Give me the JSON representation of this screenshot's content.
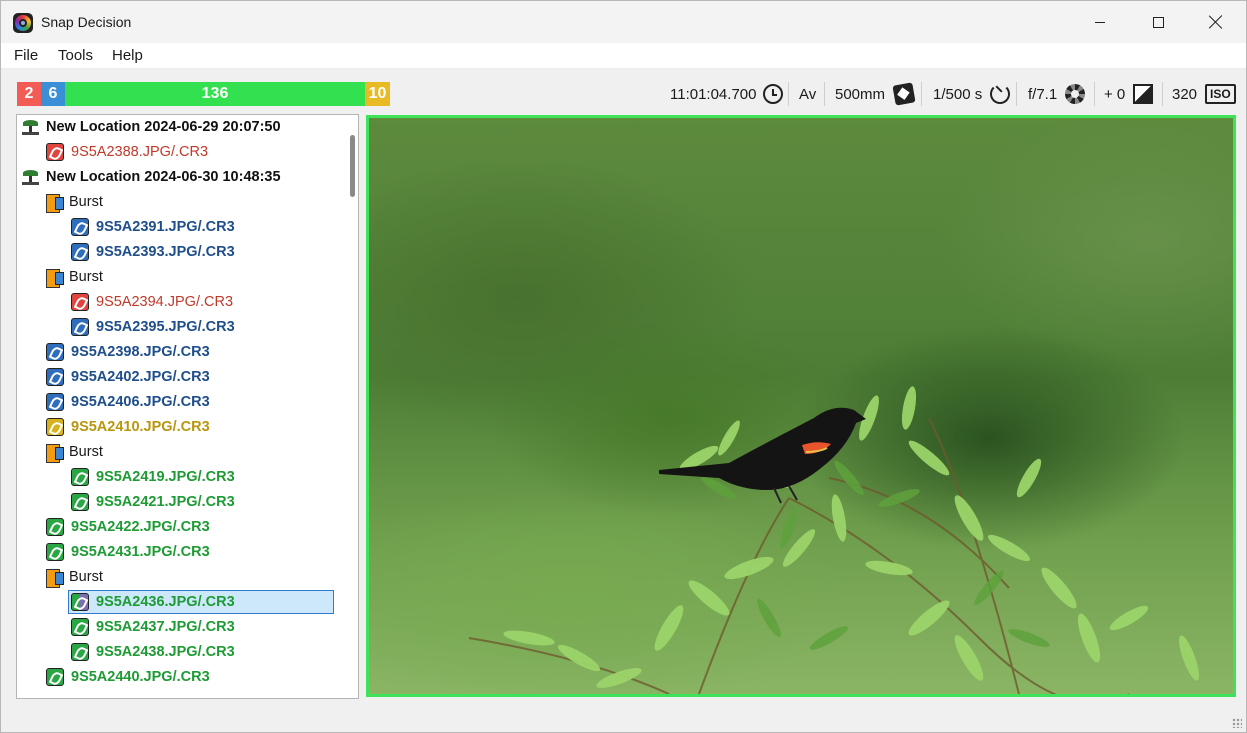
{
  "window": {
    "title": "Snap Decision"
  },
  "menu": {
    "file": "File",
    "tools": "Tools",
    "help": "Help"
  },
  "counts": {
    "rejected": "2",
    "blue": "6",
    "green": "136",
    "yellow": "10"
  },
  "exif": {
    "time": "11:01:04.700",
    "mode": "Av",
    "focal_length": "500mm",
    "shutter": "1/500 s",
    "aperture": "f/7.1",
    "exposure_comp": "+ 0",
    "iso": "320",
    "iso_badge": "ISO"
  },
  "tree": [
    {
      "kind": "location",
      "label": "New Location 2024-06-29 20:07:50"
    },
    {
      "kind": "file",
      "label": "9S5A2388.JPG/.CR3",
      "status": "rejected"
    },
    {
      "kind": "location",
      "label": "New Location 2024-06-30 10:48:35"
    },
    {
      "kind": "burst",
      "label": "Burst"
    },
    {
      "kind": "file",
      "label": "9S5A2391.JPG/.CR3",
      "status": "blue"
    },
    {
      "kind": "file",
      "label": "9S5A2393.JPG/.CR3",
      "status": "blue"
    },
    {
      "kind": "burst",
      "label": "Burst"
    },
    {
      "kind": "file",
      "label": "9S5A2394.JPG/.CR3",
      "status": "rejected"
    },
    {
      "kind": "file",
      "label": "9S5A2395.JPG/.CR3",
      "status": "blue"
    },
    {
      "kind": "file",
      "label": "9S5A2398.JPG/.CR3",
      "status": "blue"
    },
    {
      "kind": "file",
      "label": "9S5A2402.JPG/.CR3",
      "status": "blue"
    },
    {
      "kind": "file",
      "label": "9S5A2406.JPG/.CR3",
      "status": "blue"
    },
    {
      "kind": "file",
      "label": "9S5A2410.JPG/.CR3",
      "status": "yellow"
    },
    {
      "kind": "burst",
      "label": "Burst"
    },
    {
      "kind": "file",
      "label": "9S5A2419.JPG/.CR3",
      "status": "green"
    },
    {
      "kind": "file",
      "label": "9S5A2421.JPG/.CR3",
      "status": "green"
    },
    {
      "kind": "file",
      "label": "9S5A2422.JPG/.CR3",
      "status": "green"
    },
    {
      "kind": "file",
      "label": "9S5A2431.JPG/.CR3",
      "status": "green"
    },
    {
      "kind": "burst",
      "label": "Burst"
    },
    {
      "kind": "file",
      "label": "9S5A2436.JPG/.CR3",
      "status": "green",
      "selected": true
    },
    {
      "kind": "file",
      "label": "9S5A2437.JPG/.CR3",
      "status": "green"
    },
    {
      "kind": "file",
      "label": "9S5A2438.JPG/.CR3",
      "status": "green"
    },
    {
      "kind": "file",
      "label": "9S5A2440.JPG/.CR3",
      "status": "green"
    }
  ],
  "colors": {
    "rejected": "#f25c54",
    "blue": "#3b8fd6",
    "green": "#33e04f",
    "yellow": "#e8bb24",
    "photo_border": "#3ee35a"
  }
}
